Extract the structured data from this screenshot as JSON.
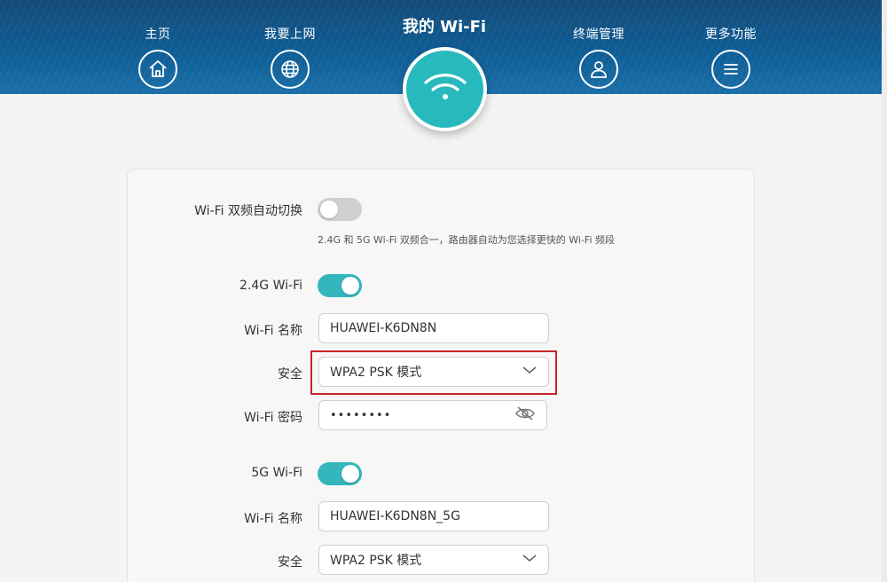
{
  "nav": {
    "home": {
      "label": "主页",
      "icon": "home-icon"
    },
    "internet": {
      "label": "我要上网",
      "icon": "globe-icon"
    },
    "wifi": {
      "label": "我的 Wi-Fi",
      "icon": "wifi-icon"
    },
    "devices": {
      "label": "终端管理",
      "icon": "user-icon"
    },
    "more": {
      "label": "更多功能",
      "icon": "menu-icon"
    }
  },
  "settings": {
    "dual_band": {
      "label": "Wi-Fi 双频自动切换",
      "enabled": false,
      "hint": "2.4G 和 5G Wi-Fi 双频合一，路由器自动为您选择更快的 Wi-Fi 频段"
    },
    "band24": {
      "label": "2.4G Wi-Fi",
      "enabled": true,
      "name_label": "Wi-Fi 名称",
      "name_value": "HUAWEI-K6DN8N",
      "security_label": "安全",
      "security_value": "WPA2 PSK 模式",
      "password_label": "Wi-Fi 密码",
      "password_mask": "••••••••"
    },
    "band5": {
      "label": "5G Wi-Fi",
      "enabled": true,
      "name_label": "Wi-Fi 名称",
      "name_value": "HUAWEI-K6DN8N_5G",
      "security_label": "安全",
      "security_value": "WPA2 PSK 模式"
    }
  },
  "colors": {
    "accent": "#33b6bc",
    "header": "#0f5d95",
    "highlight": "#c9252b"
  }
}
